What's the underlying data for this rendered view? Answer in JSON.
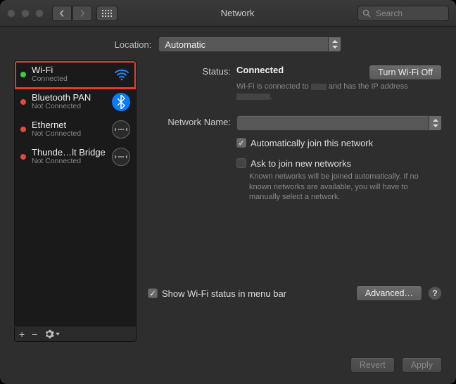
{
  "window": {
    "title": "Network",
    "search_placeholder": "Search"
  },
  "location": {
    "label": "Location:",
    "value": "Automatic"
  },
  "sidebar": {
    "items": [
      {
        "name": "Wi-Fi",
        "status": "Connected",
        "dot": "green",
        "icon": "wifi",
        "selected": true,
        "highlight": true
      },
      {
        "name": "Bluetooth PAN",
        "status": "Not Connected",
        "dot": "red",
        "icon": "bluetooth"
      },
      {
        "name": "Ethernet",
        "status": "Not Connected",
        "dot": "red",
        "icon": "ethernet"
      },
      {
        "name": "Thunde…lt Bridge",
        "status": "Not Connected",
        "dot": "red",
        "icon": "thunderbolt"
      }
    ],
    "add": "+",
    "remove": "−"
  },
  "main": {
    "status_label": "Status:",
    "status_value": "Connected",
    "toggle_button": "Turn Wi-Fi Off",
    "status_sub_pre": "Wi-Fi is connected to ",
    "status_sub_mid": " and has the IP address ",
    "status_sub_post": ".",
    "network_name_label": "Network Name:",
    "network_name_value": "",
    "auto_join": "Automatically join this network",
    "ask_join": "Ask to join new networks",
    "ask_help": "Known networks will be joined automatically. If no known networks are available, you will have to manually select a network.",
    "show_menu": "Show Wi-Fi status in menu bar",
    "advanced": "Advanced…",
    "help": "?"
  },
  "buttons": {
    "revert": "Revert",
    "apply": "Apply"
  }
}
